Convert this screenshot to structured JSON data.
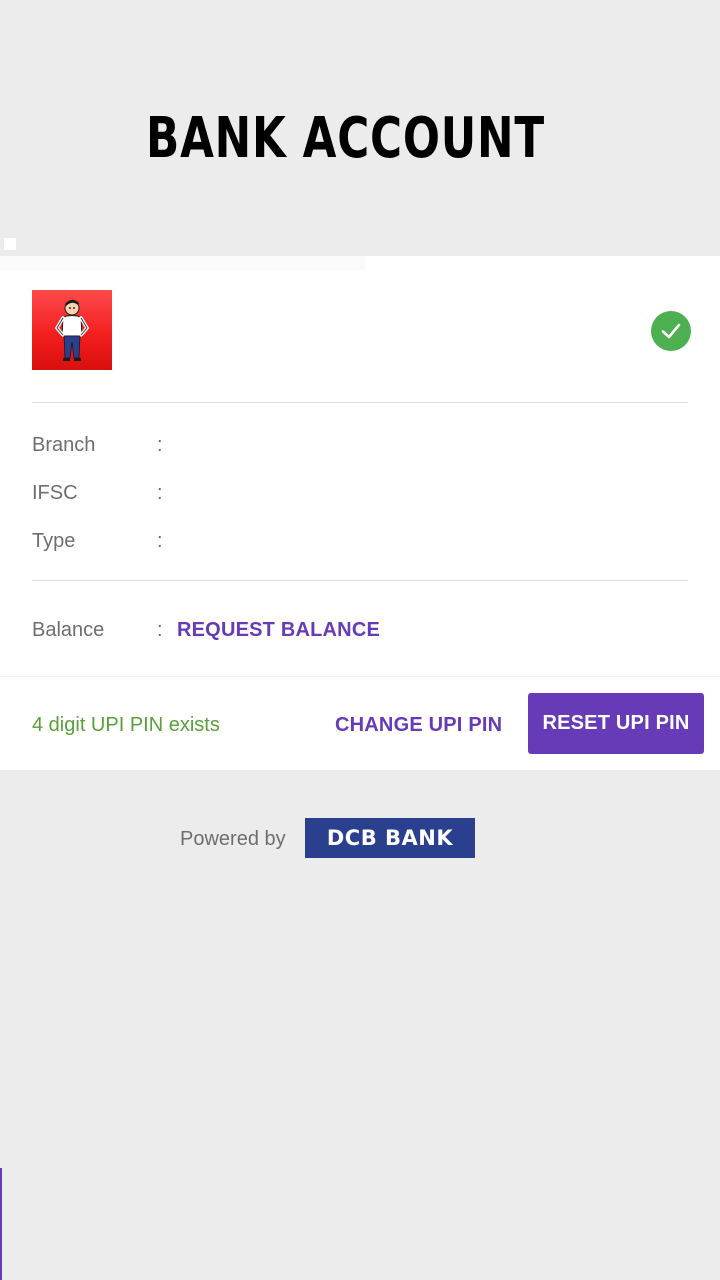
{
  "header": {
    "title": "BANK ACCOUNT"
  },
  "account": {
    "logo_icon": "bank-mascot-logo",
    "verified_icon": "check-circle-icon",
    "details": [
      {
        "label": "Branch",
        "separator": ":"
      },
      {
        "label": "IFSC",
        "separator": ":"
      },
      {
        "label": "Type",
        "separator": ":"
      }
    ],
    "balance": {
      "label": "Balance",
      "separator": ":",
      "action_label": "REQUEST BALANCE"
    }
  },
  "pin": {
    "status": "4 digit UPI PIN exists",
    "change_label": "CHANGE UPI PIN",
    "reset_label": "RESET UPI PIN"
  },
  "footer": {
    "powered_by": "Powered by",
    "partner_logo_text": "DCB BANK"
  },
  "colors": {
    "accent": "#673ab7",
    "success": "#4caf50",
    "status_text": "#5aa03a",
    "partner_brand": "#2b3f8f",
    "logo_red": "#f21c1c"
  }
}
